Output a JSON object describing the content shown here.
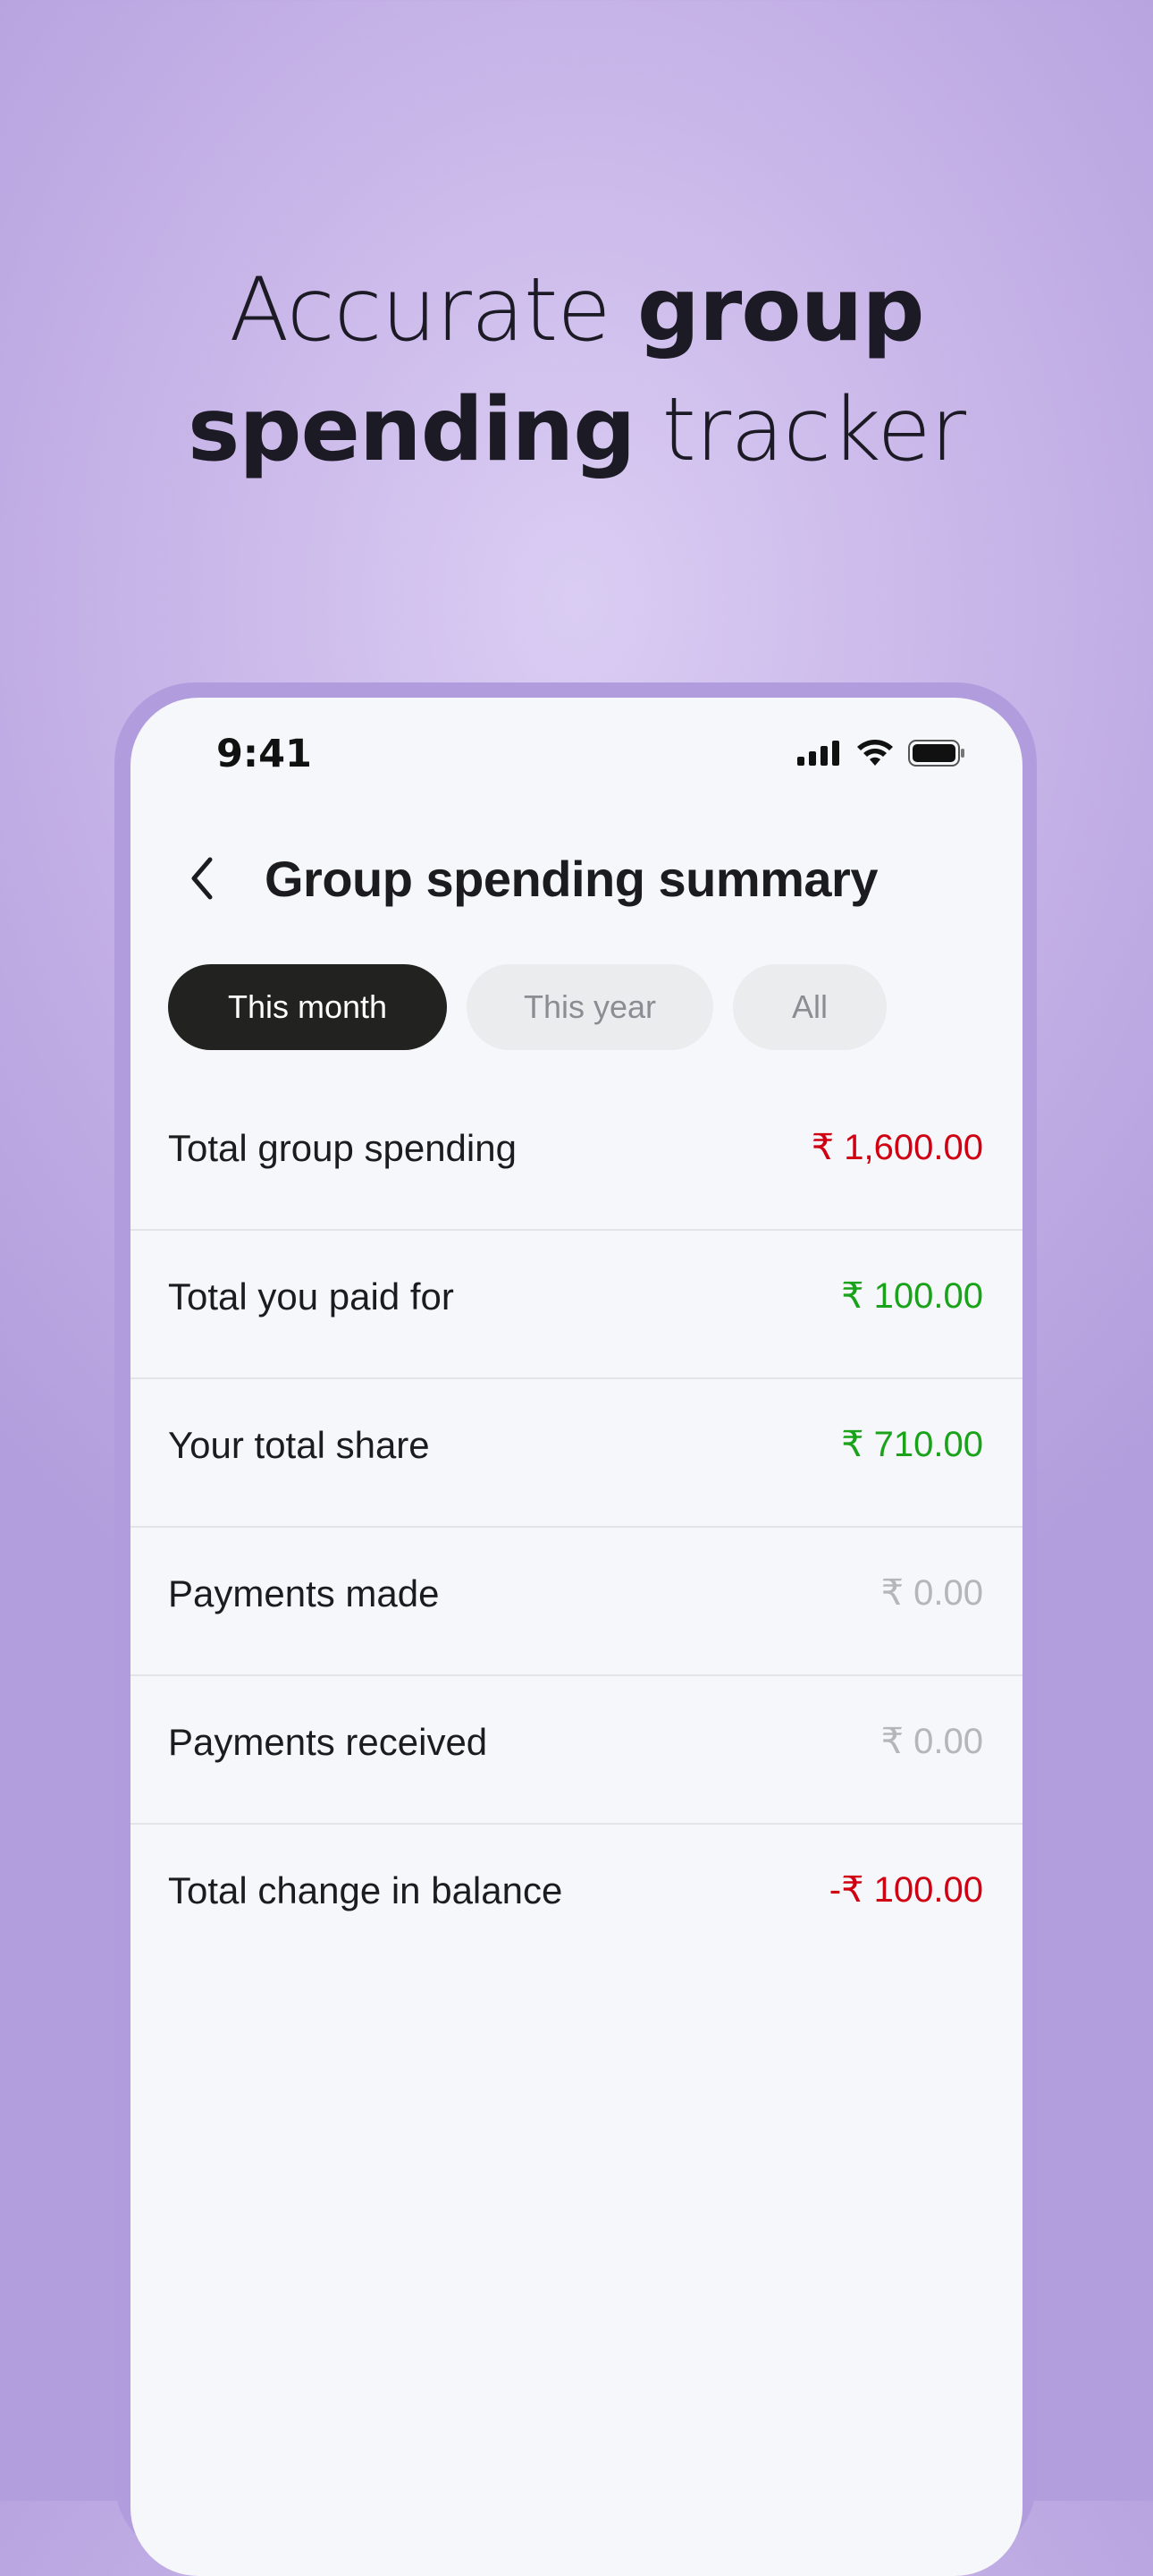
{
  "headline": {
    "line1_light": "Accurate ",
    "line1_bold": "group",
    "line2_bold": "spending",
    "line2_light": " tracker"
  },
  "status_bar": {
    "time": "9:41",
    "icons": [
      "cellular-signal-icon",
      "wifi-icon",
      "battery-icon"
    ]
  },
  "nav": {
    "back_icon": "chevron-left-icon",
    "title": "Group spending summary"
  },
  "tabs": [
    {
      "label": "This month",
      "selected": true
    },
    {
      "label": "This year",
      "selected": false
    },
    {
      "label": "All",
      "selected": false
    }
  ],
  "summary_rows": [
    {
      "label": "Total group spending",
      "value": "₹ 1,600.00",
      "tone": "red"
    },
    {
      "label": "Total you paid for",
      "value": "₹ 100.00",
      "tone": "green"
    },
    {
      "label": "Your total share",
      "value": "₹ 710.00",
      "tone": "green"
    },
    {
      "label": "Payments made",
      "value": "₹ 0.00",
      "tone": "gray"
    },
    {
      "label": "Payments received",
      "value": "₹ 0.00",
      "tone": "gray"
    },
    {
      "label": "Total change in balance",
      "value": "-₹ 100.00",
      "tone": "red"
    }
  ],
  "colors": {
    "background_center": "#dacdf3",
    "background_edge": "#b29edc",
    "phone_frame": "#b19ddd",
    "screen_bg": "#f5f7fa",
    "negative": "#d00012",
    "positive": "#1aa31a",
    "neutral": "#b4b6bb",
    "tab_active_bg": "#222221",
    "tab_inactive_bg": "#ebecee"
  }
}
